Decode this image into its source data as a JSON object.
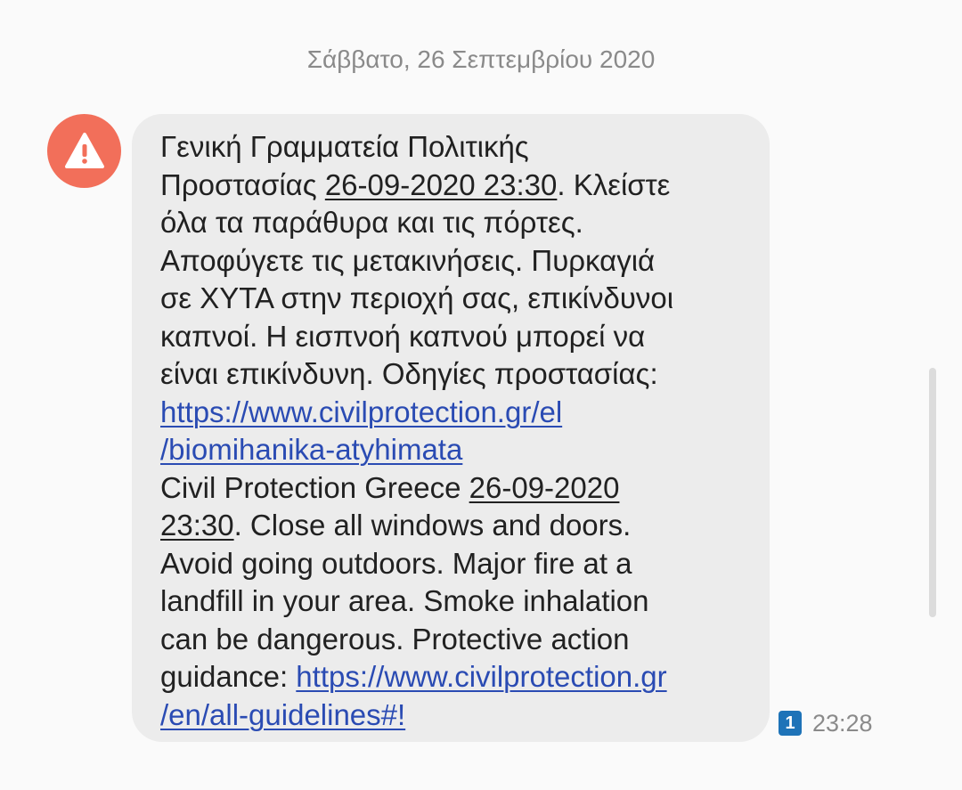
{
  "conversation": {
    "date_separator": "Σάββατο, 26 Σεπτεμβρίου 2020"
  },
  "message": {
    "avatar_icon": "warning-icon",
    "avatar_color": "#f26f5a",
    "bubble_color": "#ececec",
    "link_color": "#2a4bb3",
    "lines": [
      [
        {
          "text": "Γενική Γραμματεία Πολιτικής"
        }
      ],
      [
        {
          "text": "Προστασίας "
        },
        {
          "text": "26-09-2020 23:30",
          "kind": "date"
        },
        {
          "text": ". Κλείστε"
        }
      ],
      [
        {
          "text": "όλα τα παράθυρα και τις πόρτες."
        }
      ],
      [
        {
          "text": "Αποφύγετε τις μετακινήσεις. Πυρκαγιά"
        }
      ],
      [
        {
          "text": "σε ΧΥΤΑ στην περιοχή σας, επικίνδυνοι"
        }
      ],
      [
        {
          "text": "καπνοί. Η εισπνοή καπνού μπορεί να"
        }
      ],
      [
        {
          "text": "είναι επικίνδυνη. Οδηγίες προστασίας:"
        }
      ],
      [
        {
          "text": "https://www.civilprotection.gr/el",
          "kind": "url"
        }
      ],
      [
        {
          "text": "/biomihanika-atyhimata",
          "kind": "url"
        }
      ],
      [
        {
          "text": "Civil Protection Greece "
        },
        {
          "text": "26-09-2020",
          "kind": "date"
        }
      ],
      [
        {
          "text": "23:30",
          "kind": "date"
        },
        {
          "text": ". Close all windows and doors."
        }
      ],
      [
        {
          "text": "Avoid going outdoors. Major fire at a"
        }
      ],
      [
        {
          "text": "landfill in your area. Smoke inhalation"
        }
      ],
      [
        {
          "text": "can be dangerous. Protective action"
        }
      ],
      [
        {
          "text": "guidance: "
        },
        {
          "text": "https://www.civilprotection.gr",
          "kind": "url"
        }
      ],
      [
        {
          "text": "/en/all-guidelines#!",
          "kind": "url"
        }
      ]
    ],
    "sim_label": "1",
    "sim_color": "#1e73b8",
    "time": "23:28"
  }
}
